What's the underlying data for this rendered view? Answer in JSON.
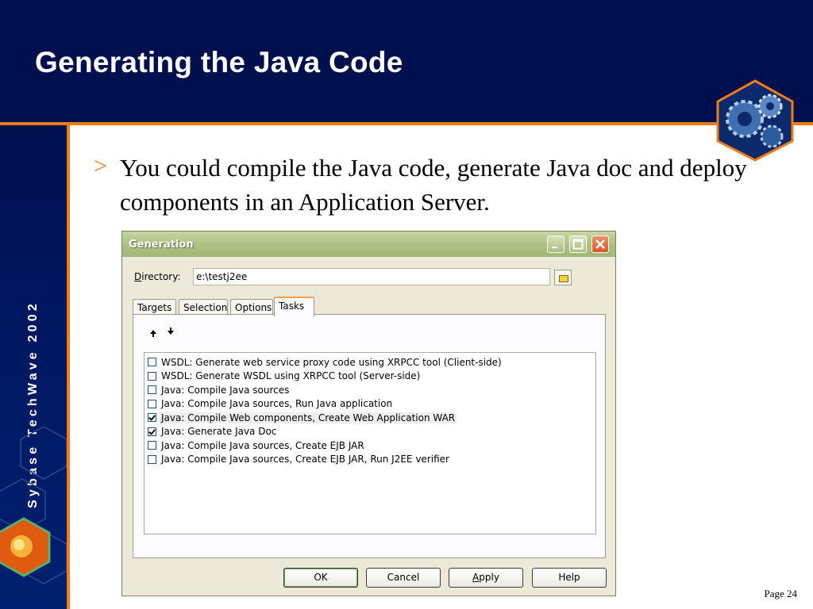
{
  "slide": {
    "title": "Generating the Java Code",
    "sidebar_brand": "Sybase TechWave 2002",
    "bullet_marker": ">",
    "bullet_text": "You could compile the Java code, generate Java doc and deploy components in an Application Server.",
    "page_number": "Page 24",
    "colors": {
      "navy": "#00104f",
      "accent": "#f07c17"
    }
  },
  "dialog": {
    "title": "Generation",
    "window_buttons": [
      "minimize-icon",
      "maximize-icon",
      "close-icon"
    ],
    "directory": {
      "label_prefix": "D",
      "label_rest": "irectory:",
      "value": "e:\\testj2ee"
    },
    "tabs": [
      {
        "label": "Targets"
      },
      {
        "label": "Selection"
      },
      {
        "label": "Options"
      },
      {
        "label": "Tasks",
        "active": true
      }
    ],
    "tasks": [
      {
        "label": "WSDL: Generate web service proxy code using XRPCC tool (Client-side)",
        "checked": false
      },
      {
        "label": "WSDL: Generate WSDL using XRPCC tool (Server-side)",
        "checked": false
      },
      {
        "label": "Java: Compile Java sources",
        "checked": false
      },
      {
        "label": "Java: Compile Java sources, Run Java application",
        "checked": false
      },
      {
        "label": "Java: Compile Web components, Create Web Application WAR",
        "checked": true
      },
      {
        "label": "Java: Generate Java Doc",
        "checked": true
      },
      {
        "label": "Java: Compile Java sources, Create EJB JAR",
        "checked": false
      },
      {
        "label": "Java: Compile Java sources, Create EJB JAR, Run J2EE verifier",
        "checked": false
      }
    ],
    "buttons": {
      "ok": "OK",
      "cancel": "Cancel",
      "apply_underline": "A",
      "apply_rest": "pply",
      "help": "Help"
    }
  }
}
